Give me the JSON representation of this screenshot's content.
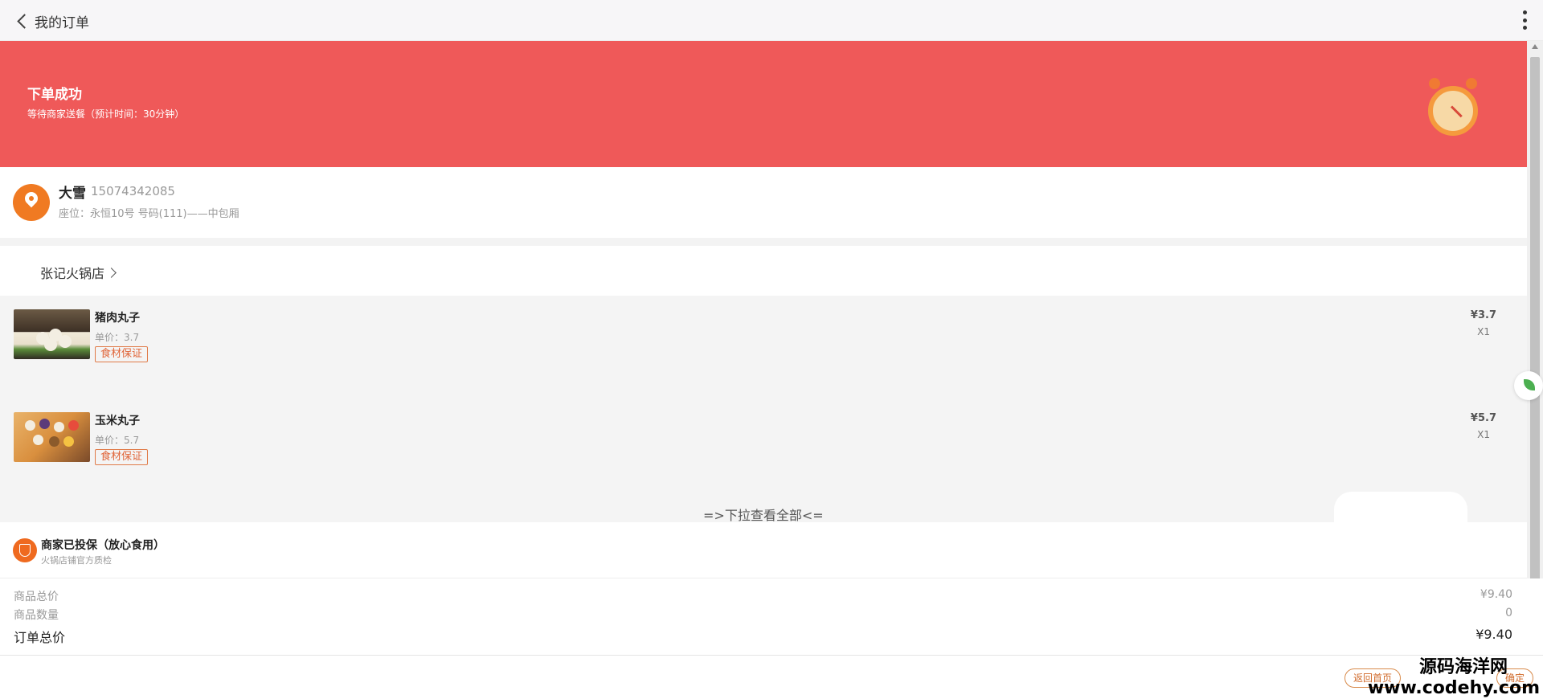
{
  "header": {
    "title": "我的订单"
  },
  "banner": {
    "title": "下单成功",
    "subtitle": "等待商家送餐（预计时间：30分钟）"
  },
  "address": {
    "name": "大雪",
    "phone": "15074342085",
    "seat": "座位：永恒10号 号码(111)——中包厢"
  },
  "shop": {
    "name": "张记火锅店"
  },
  "items": [
    {
      "name": "猪肉丸子",
      "unit_price": "单价：3.7",
      "tag": "食材保证",
      "total": "¥3.7",
      "qty": "X1"
    },
    {
      "name": "玉米丸子",
      "unit_price": "单价：5.7",
      "tag": "食材保证",
      "total": "¥5.7",
      "qty": "X1"
    }
  ],
  "pull_hint": "=>下拉查看全部<=",
  "insured": {
    "title": "商家已投保（放心食用）",
    "subtitle": "火锅店铺官方质检"
  },
  "summary": {
    "goods_total_label": "商品总价",
    "goods_total": "¥9.40",
    "goods_count_label": "商品数量",
    "goods_count": "0",
    "order_total_label": "订单总价",
    "order_total": "¥9.40"
  },
  "actions": {
    "home": "返回首页",
    "confirm": "确定"
  },
  "watermark": {
    "line1": "源码海洋网",
    "line2": "www.codehy.com"
  },
  "colors": {
    "banner": "#ef5959",
    "accent": "#f07a22"
  }
}
